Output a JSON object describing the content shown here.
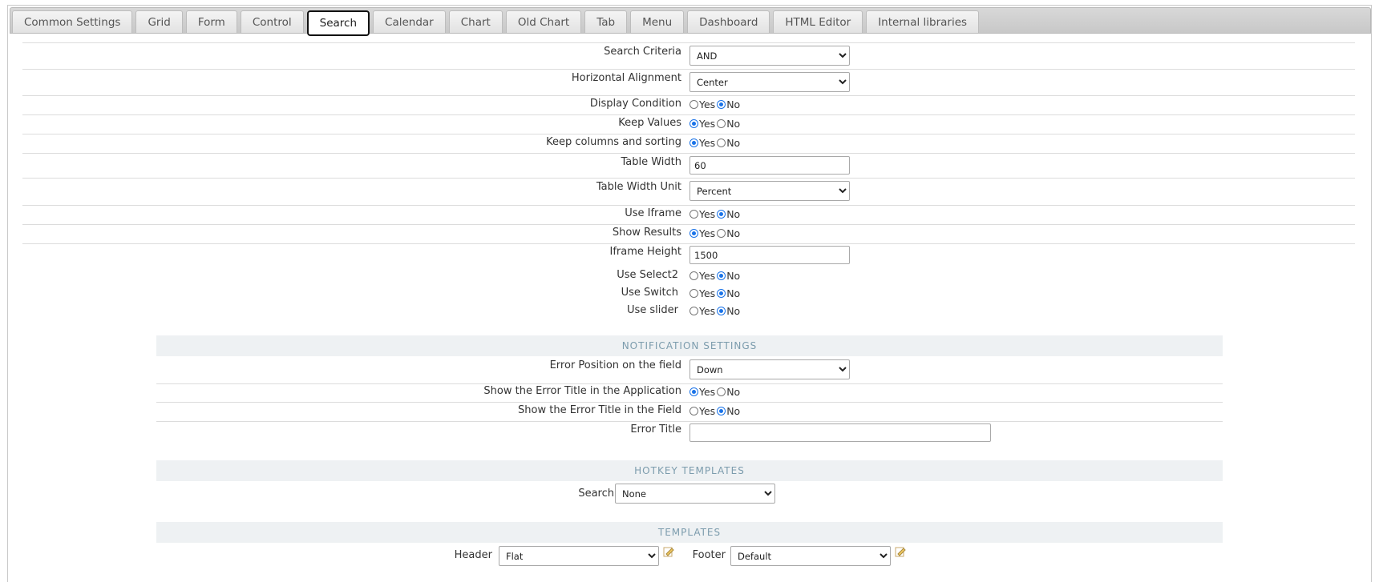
{
  "tabs": [
    "Common Settings",
    "Grid",
    "Form",
    "Control",
    "Search",
    "Calendar",
    "Chart",
    "Old Chart",
    "Tab",
    "Menu",
    "Dashboard",
    "HTML Editor",
    "Internal libraries"
  ],
  "active_tab": "Search",
  "radio_yes": "Yes",
  "radio_no": "No",
  "fields": {
    "search_criteria": {
      "label": "Search Criteria",
      "value": "AND"
    },
    "horizontal_alignment": {
      "label": "Horizontal Alignment",
      "value": "Center"
    },
    "display_condition": {
      "label": "Display Condition",
      "selected": "No"
    },
    "keep_values": {
      "label": "Keep Values",
      "selected": "Yes"
    },
    "keep_columns": {
      "label": "Keep columns and sorting",
      "selected": "Yes"
    },
    "table_width": {
      "label": "Table Width",
      "value": "60"
    },
    "table_width_unit": {
      "label": "Table Width Unit",
      "value": "Percent"
    },
    "use_iframe": {
      "label": "Use Iframe",
      "selected": "No"
    },
    "show_results": {
      "label": "Show Results",
      "selected": "Yes"
    },
    "iframe_height": {
      "label": "Iframe Height",
      "value": "1500"
    },
    "use_select2": {
      "label": "Use Select2",
      "selected": "No"
    },
    "use_switch": {
      "label": "Use Switch",
      "selected": "No"
    },
    "use_slider": {
      "label": "Use slider",
      "selected": "No"
    }
  },
  "notification": {
    "title": "NOTIFICATION SETTINGS",
    "error_position": {
      "label": "Error Position on the field",
      "value": "Down"
    },
    "error_title_app": {
      "label": "Show the Error Title in the Application",
      "selected": "Yes"
    },
    "error_title_field": {
      "label": "Show the Error Title in the Field",
      "selected": "No"
    },
    "error_title": {
      "label": "Error Title",
      "value": ""
    }
  },
  "hotkey": {
    "title": "HOTKEY TEMPLATES",
    "search": {
      "label": "Search",
      "value": "None"
    }
  },
  "templates": {
    "title": "TEMPLATES",
    "header": {
      "label": "Header",
      "value": "Flat"
    },
    "footer": {
      "label": "Footer",
      "value": "Default"
    }
  },
  "colors": {
    "accent": "#1a73e8",
    "section_bg": "#eef1f3",
    "section_text": "#7c9cad"
  }
}
